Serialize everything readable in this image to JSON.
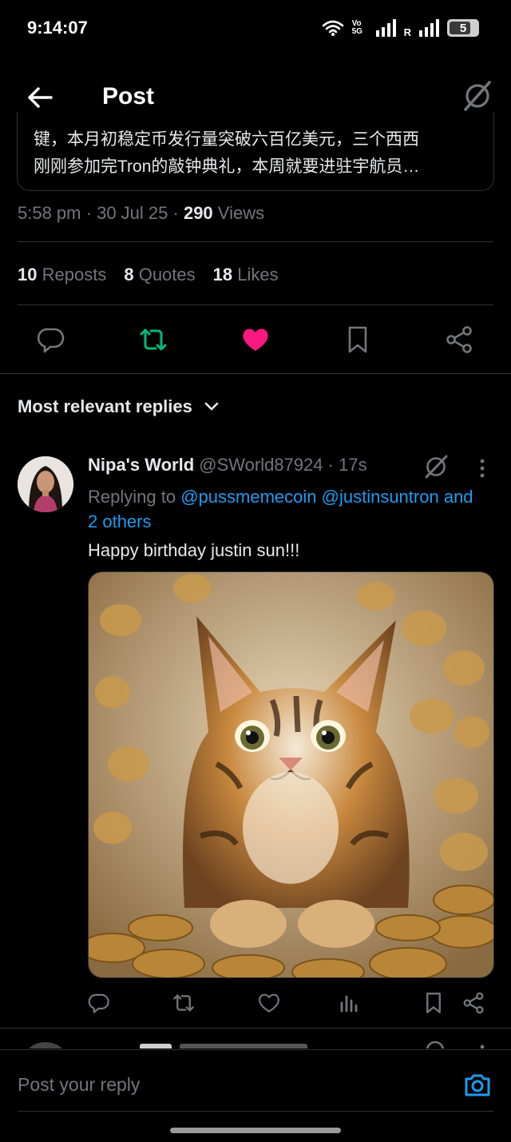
{
  "status_bar": {
    "time": "9:14:07",
    "network_label": "Vo 5G",
    "roaming_label": "R",
    "battery_level": "5"
  },
  "header": {
    "title": "Post"
  },
  "quoted_post": {
    "line1": "键，本月初稳定币发行量突破六百亿美元，三个西西",
    "line2": "刚刚参加完Tron的敲钟典礼，本周就要进驻宇航员…"
  },
  "post_meta": {
    "time": "5:58 pm",
    "separator": "·",
    "date": "30 Jul 25",
    "views_count": "290",
    "views_label": "Views"
  },
  "post_stats": {
    "reposts_count": "10",
    "reposts_label": "Reposts",
    "quotes_count": "8",
    "quotes_label": "Quotes",
    "likes_count": "18",
    "likes_label": "Likes"
  },
  "colors": {
    "accent_blue": "#1d9bf0",
    "repost_green": "#00ba7c",
    "like_pink": "#f91880",
    "muted_text": "#71767b",
    "divider": "#2f3336"
  },
  "replies_sort": {
    "label": "Most relevant replies"
  },
  "reply": {
    "name": "Nipa's World",
    "handle": "@SWorld87924",
    "separator": "·",
    "time": "17s",
    "replying_prefix": "Replying to",
    "mention1": "@pussmemecoin",
    "mention2": "@justinsuntron",
    "others": "and 2 others",
    "text": "Happy birthday justin sun!!!"
  },
  "composer": {
    "placeholder": "Post your reply"
  }
}
